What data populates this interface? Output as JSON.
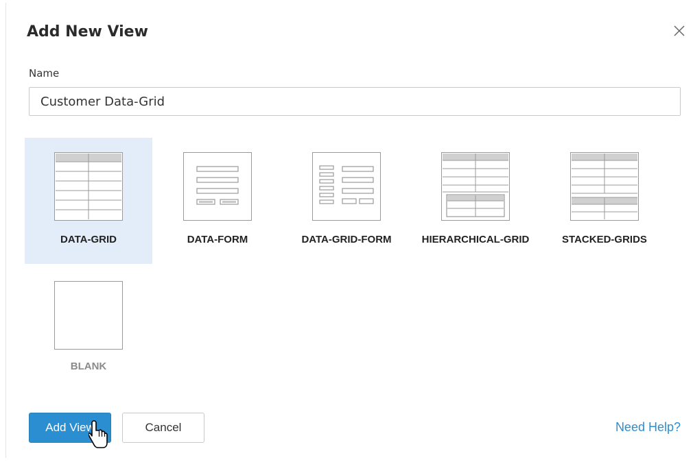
{
  "dialog": {
    "title": "Add New View",
    "close_icon": "close-icon"
  },
  "form": {
    "name_label": "Name",
    "name_value": "Customer Data-Grid"
  },
  "view_types": [
    {
      "id": "data-grid",
      "label": "DATA-GRID",
      "selected": true
    },
    {
      "id": "data-form",
      "label": "DATA-FORM",
      "selected": false
    },
    {
      "id": "data-grid-form",
      "label": "DATA-GRID-FORM",
      "selected": false
    },
    {
      "id": "hierarchical-grid",
      "label": "HIERARCHICAL-GRID",
      "selected": false
    },
    {
      "id": "stacked-grids",
      "label": "STACKED-GRIDS",
      "selected": false
    },
    {
      "id": "blank",
      "label": "BLANK",
      "selected": false
    }
  ],
  "footer": {
    "add_label": "Add View",
    "cancel_label": "Cancel",
    "help_label": "Need Help?"
  },
  "colors": {
    "accent": "#2b8ed1",
    "selected_tile": "#e3ecf9"
  }
}
